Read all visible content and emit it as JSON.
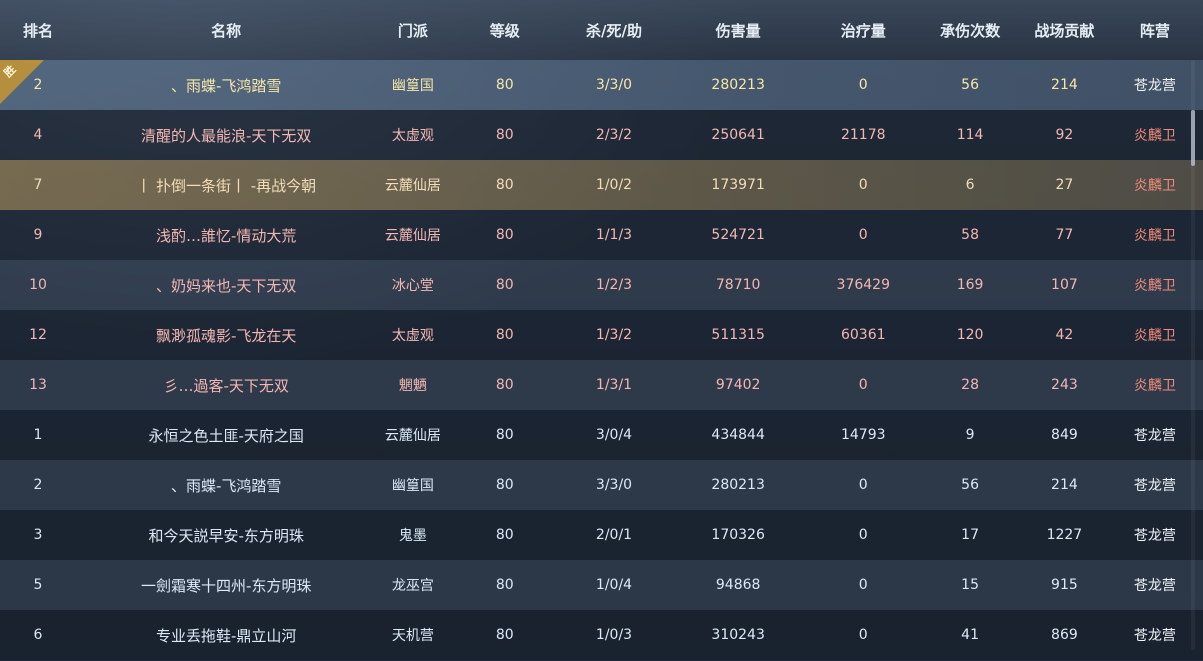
{
  "header": [
    "排名",
    "名称",
    "门派",
    "等级",
    "杀/死/助",
    "伤害量",
    "治疗量",
    "承伤次数",
    "战场贡献",
    "阵营"
  ],
  "win_badge": "胜",
  "rows": [
    {
      "rank": "2",
      "name": "、雨蝶-飞鸿踏雪",
      "school": "幽篁国",
      "level": "80",
      "kda": "3/3/0",
      "damage": "280213",
      "heal": "0",
      "hits": "56",
      "contrib": "214",
      "faction": "苍龙营",
      "style": "highlight-blue top-gold"
    },
    {
      "rank": "4",
      "name": "清醒的人最能浪-天下无双",
      "school": "太虚观",
      "level": "80",
      "kda": "2/3/2",
      "damage": "250641",
      "heal": "21178",
      "hits": "114",
      "contrib": "92",
      "faction": "炎麟卫",
      "style": "dark enemy"
    },
    {
      "rank": "7",
      "name": "丨 扑倒一条街丨 -再战今朝",
      "school": "云麓仙居",
      "level": "80",
      "kda": "1/0/2",
      "damage": "173971",
      "heal": "0",
      "hits": "6",
      "contrib": "27",
      "faction": "炎麟卫",
      "style": "highlight-gold gold-sel"
    },
    {
      "rank": "9",
      "name": "浅酌…誰忆-情动大荒",
      "school": "云麓仙居",
      "level": "80",
      "kda": "1/1/3",
      "damage": "524721",
      "heal": "0",
      "hits": "58",
      "contrib": "77",
      "faction": "炎麟卫",
      "style": "dark enemy"
    },
    {
      "rank": "10",
      "name": "、奶妈来也-天下无双",
      "school": "冰心堂",
      "level": "80",
      "kda": "1/2/3",
      "damage": "78710",
      "heal": "376429",
      "hits": "169",
      "contrib": "107",
      "faction": "炎麟卫",
      "style": "light enemy"
    },
    {
      "rank": "12",
      "name": "飘渺孤魂影-飞龙在天",
      "school": "太虚观",
      "level": "80",
      "kda": "1/3/2",
      "damage": "511315",
      "heal": "60361",
      "hits": "120",
      "contrib": "42",
      "faction": "炎麟卫",
      "style": "dark enemy"
    },
    {
      "rank": "13",
      "name": "彡…過客-天下无双",
      "school": "魍魉",
      "level": "80",
      "kda": "1/3/1",
      "damage": "97402",
      "heal": "0",
      "hits": "28",
      "contrib": "243",
      "faction": "炎麟卫",
      "style": "light enemy"
    },
    {
      "rank": "1",
      "name": "永恒之色土匪-天府之国",
      "school": "云麓仙居",
      "level": "80",
      "kda": "3/0/4",
      "damage": "434844",
      "heal": "14793",
      "hits": "9",
      "contrib": "849",
      "faction": "苍龙营",
      "style": "dark ally"
    },
    {
      "rank": "2",
      "name": "、雨蝶-飞鸿踏雪",
      "school": "幽篁国",
      "level": "80",
      "kda": "3/3/0",
      "damage": "280213",
      "heal": "0",
      "hits": "56",
      "contrib": "214",
      "faction": "苍龙营",
      "style": "light ally"
    },
    {
      "rank": "3",
      "name": "和今天説早安-东方明珠",
      "school": "鬼墨",
      "level": "80",
      "kda": "2/0/1",
      "damage": "170326",
      "heal": "0",
      "hits": "17",
      "contrib": "1227",
      "faction": "苍龙营",
      "style": "dark ally"
    },
    {
      "rank": "5",
      "name": "一劍霜寒十四州-东方明珠",
      "school": "龙巫宫",
      "level": "80",
      "kda": "1/0/4",
      "damage": "94868",
      "heal": "0",
      "hits": "15",
      "contrib": "915",
      "faction": "苍龙营",
      "style": "light ally"
    },
    {
      "rank": "6",
      "name": "专业丢拖鞋-鼎立山河",
      "school": "天机营",
      "level": "80",
      "kda": "1/0/3",
      "damage": "310243",
      "heal": "0",
      "hits": "41",
      "contrib": "869",
      "faction": "苍龙营",
      "style": "dark ally"
    }
  ]
}
